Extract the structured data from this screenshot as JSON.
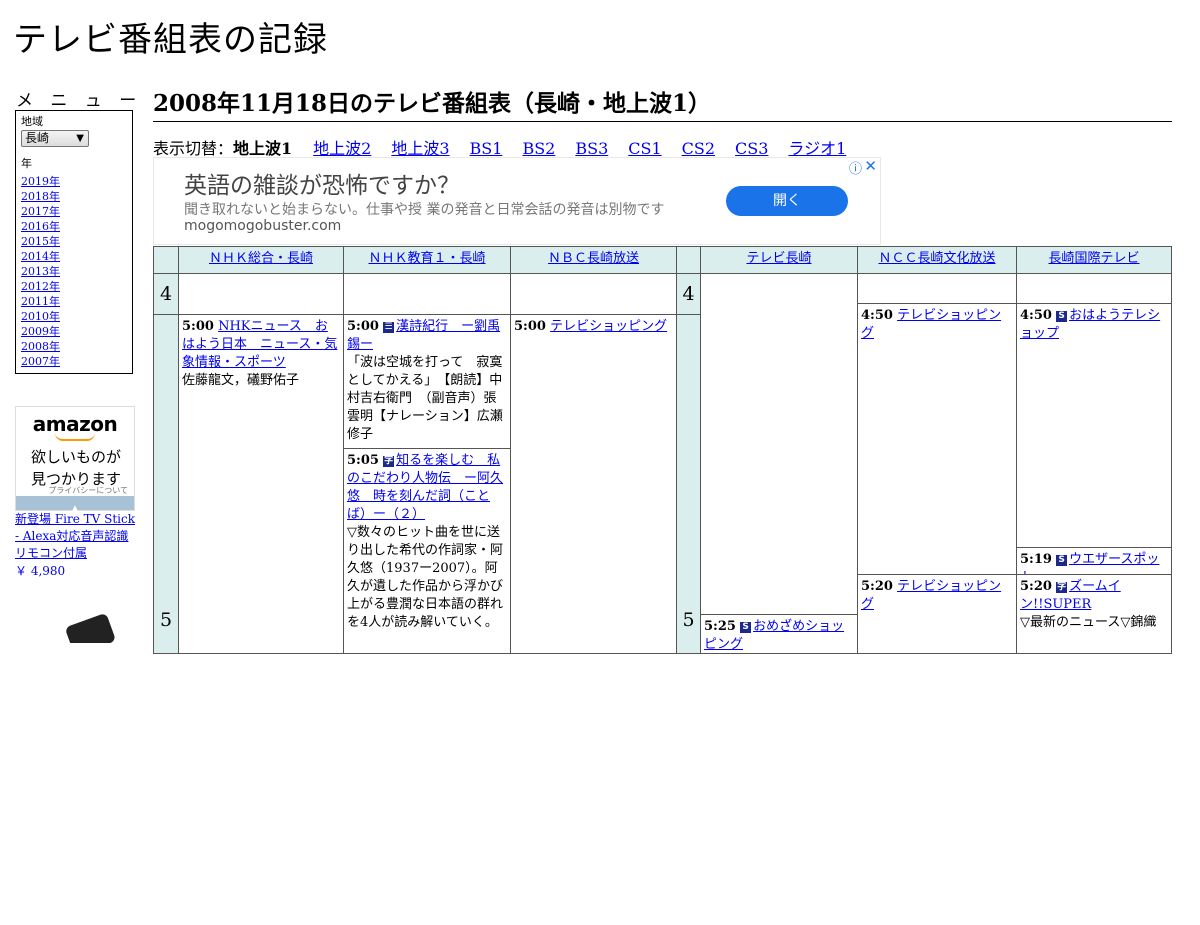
{
  "site_title": "テレビ番組表の記録",
  "menu": {
    "heading": "メ ニ ュ ー",
    "region_label": "地域",
    "region_value": "長崎",
    "year_label": "年",
    "years": [
      "2019年",
      "2018年",
      "2017年",
      "2016年",
      "2015年",
      "2014年",
      "2013年",
      "2012年",
      "2011年",
      "2010年",
      "2009年",
      "2008年",
      "2007年"
    ]
  },
  "amazon_ad": {
    "logo": "amazon",
    "catch": "欲しいものが見つかります",
    "privacy": "プライバシーについて",
    "product": "新登場 Fire TV Stick - Alexa対応音声認識リモコン付属",
    "price": "￥ 4,980"
  },
  "page_title": "2008年11月18日のテレビ番組表（長崎・地上波1）",
  "switch": {
    "label": "表示切替：",
    "current": "地上波1",
    "links": [
      "地上波2",
      "地上波3",
      "BS1",
      "BS2",
      "BS3",
      "CS1",
      "CS2",
      "CS3",
      "ラジオ1"
    ]
  },
  "banner_ad": {
    "headline": "英語の雑談が恐怖ですか？",
    "description": "聞き取れないと始まらない。仕事や授 業の発音と日常会話の発音は別物です",
    "domain": "mogomogobuster.com",
    "button": "開く",
    "info_icon": "info-icon",
    "close_icon": "close-icon"
  },
  "channels": [
    "ＮＨＫ総合・長崎",
    "ＮＨＫ教育１・長崎",
    "ＮＢＣ長崎放送",
    "テレビ長崎",
    "ＮＣＣ長崎文化放送",
    "長崎国際テレビ"
  ],
  "hours": [
    "4",
    "5"
  ],
  "programs": {
    "nhk_g_1": {
      "time": "5:00",
      "title": "NHKニュース　おはよう日本　ニュース・気象情報・スポーツ",
      "desc": "佐藤龍文，礒野佑子"
    },
    "nhk_e_1": {
      "time": "5:00",
      "icon": "文",
      "title": "漢詩紀行　ー劉禹錫ー",
      "desc": "「波は空城を打って　寂寞としてかえる」　【朗読】中村吉右衛門　（副音声）張　雲明【ナレーション】広瀬修子"
    },
    "nhk_e_2": {
      "time": "5:05",
      "icon": "字",
      "title": "知るを楽しむ　私のこだわり人物伝　ー阿久悠　時を刻んだ詞（ことば）ー（２）",
      "desc": "▽数々のヒット曲を世に送り出した希代の作詞家・阿久悠（1937ー2007）。阿久が遺した作品から浮かび上がる豊潤な日本語の群れを4人が読み解いていく。"
    },
    "nbc_1": {
      "time": "5:00",
      "title": "テレビショッピング"
    },
    "ktn_1": {
      "time": "5:25",
      "icon": "S",
      "title": "おめざめショッピング"
    },
    "ncc_1": {
      "time": "4:50",
      "title": "テレビショッピング"
    },
    "ncc_2": {
      "time": "5:20",
      "title": "テレビショッピング"
    },
    "nib_1": {
      "time": "4:50",
      "icon": "S",
      "title": "おはようテレショップ"
    },
    "nib_2": {
      "time": "5:19",
      "icon": "S",
      "title": "ウエザースポット"
    },
    "nib_3": {
      "time": "5:20",
      "icon": "字",
      "title": "ズームイン!!SUPER",
      "desc": "▽最新のニュース▽錦織"
    }
  }
}
